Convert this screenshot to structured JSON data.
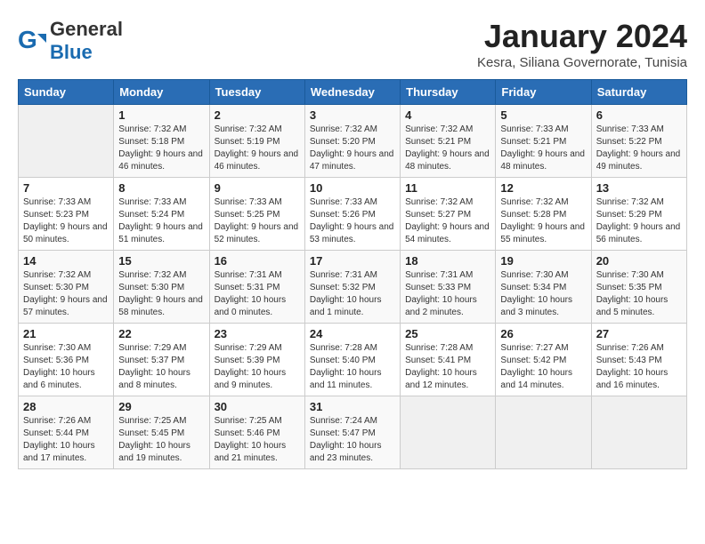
{
  "header": {
    "logo_general": "General",
    "logo_blue": "Blue",
    "month_year": "January 2024",
    "location": "Kesra, Siliana Governorate, Tunisia"
  },
  "weekdays": [
    "Sunday",
    "Monday",
    "Tuesday",
    "Wednesday",
    "Thursday",
    "Friday",
    "Saturday"
  ],
  "weeks": [
    [
      {
        "day": "",
        "sunrise": "",
        "sunset": "",
        "daylight": ""
      },
      {
        "day": "1",
        "sunrise": "Sunrise: 7:32 AM",
        "sunset": "Sunset: 5:18 PM",
        "daylight": "Daylight: 9 hours and 46 minutes."
      },
      {
        "day": "2",
        "sunrise": "Sunrise: 7:32 AM",
        "sunset": "Sunset: 5:19 PM",
        "daylight": "Daylight: 9 hours and 46 minutes."
      },
      {
        "day": "3",
        "sunrise": "Sunrise: 7:32 AM",
        "sunset": "Sunset: 5:20 PM",
        "daylight": "Daylight: 9 hours and 47 minutes."
      },
      {
        "day": "4",
        "sunrise": "Sunrise: 7:32 AM",
        "sunset": "Sunset: 5:21 PM",
        "daylight": "Daylight: 9 hours and 48 minutes."
      },
      {
        "day": "5",
        "sunrise": "Sunrise: 7:33 AM",
        "sunset": "Sunset: 5:21 PM",
        "daylight": "Daylight: 9 hours and 48 minutes."
      },
      {
        "day": "6",
        "sunrise": "Sunrise: 7:33 AM",
        "sunset": "Sunset: 5:22 PM",
        "daylight": "Daylight: 9 hours and 49 minutes."
      }
    ],
    [
      {
        "day": "7",
        "sunrise": "Sunrise: 7:33 AM",
        "sunset": "Sunset: 5:23 PM",
        "daylight": "Daylight: 9 hours and 50 minutes."
      },
      {
        "day": "8",
        "sunrise": "Sunrise: 7:33 AM",
        "sunset": "Sunset: 5:24 PM",
        "daylight": "Daylight: 9 hours and 51 minutes."
      },
      {
        "day": "9",
        "sunrise": "Sunrise: 7:33 AM",
        "sunset": "Sunset: 5:25 PM",
        "daylight": "Daylight: 9 hours and 52 minutes."
      },
      {
        "day": "10",
        "sunrise": "Sunrise: 7:33 AM",
        "sunset": "Sunset: 5:26 PM",
        "daylight": "Daylight: 9 hours and 53 minutes."
      },
      {
        "day": "11",
        "sunrise": "Sunrise: 7:32 AM",
        "sunset": "Sunset: 5:27 PM",
        "daylight": "Daylight: 9 hours and 54 minutes."
      },
      {
        "day": "12",
        "sunrise": "Sunrise: 7:32 AM",
        "sunset": "Sunset: 5:28 PM",
        "daylight": "Daylight: 9 hours and 55 minutes."
      },
      {
        "day": "13",
        "sunrise": "Sunrise: 7:32 AM",
        "sunset": "Sunset: 5:29 PM",
        "daylight": "Daylight: 9 hours and 56 minutes."
      }
    ],
    [
      {
        "day": "14",
        "sunrise": "Sunrise: 7:32 AM",
        "sunset": "Sunset: 5:30 PM",
        "daylight": "Daylight: 9 hours and 57 minutes."
      },
      {
        "day": "15",
        "sunrise": "Sunrise: 7:32 AM",
        "sunset": "Sunset: 5:30 PM",
        "daylight": "Daylight: 9 hours and 58 minutes."
      },
      {
        "day": "16",
        "sunrise": "Sunrise: 7:31 AM",
        "sunset": "Sunset: 5:31 PM",
        "daylight": "Daylight: 10 hours and 0 minutes."
      },
      {
        "day": "17",
        "sunrise": "Sunrise: 7:31 AM",
        "sunset": "Sunset: 5:32 PM",
        "daylight": "Daylight: 10 hours and 1 minute."
      },
      {
        "day": "18",
        "sunrise": "Sunrise: 7:31 AM",
        "sunset": "Sunset: 5:33 PM",
        "daylight": "Daylight: 10 hours and 2 minutes."
      },
      {
        "day": "19",
        "sunrise": "Sunrise: 7:30 AM",
        "sunset": "Sunset: 5:34 PM",
        "daylight": "Daylight: 10 hours and 3 minutes."
      },
      {
        "day": "20",
        "sunrise": "Sunrise: 7:30 AM",
        "sunset": "Sunset: 5:35 PM",
        "daylight": "Daylight: 10 hours and 5 minutes."
      }
    ],
    [
      {
        "day": "21",
        "sunrise": "Sunrise: 7:30 AM",
        "sunset": "Sunset: 5:36 PM",
        "daylight": "Daylight: 10 hours and 6 minutes."
      },
      {
        "day": "22",
        "sunrise": "Sunrise: 7:29 AM",
        "sunset": "Sunset: 5:37 PM",
        "daylight": "Daylight: 10 hours and 8 minutes."
      },
      {
        "day": "23",
        "sunrise": "Sunrise: 7:29 AM",
        "sunset": "Sunset: 5:39 PM",
        "daylight": "Daylight: 10 hours and 9 minutes."
      },
      {
        "day": "24",
        "sunrise": "Sunrise: 7:28 AM",
        "sunset": "Sunset: 5:40 PM",
        "daylight": "Daylight: 10 hours and 11 minutes."
      },
      {
        "day": "25",
        "sunrise": "Sunrise: 7:28 AM",
        "sunset": "Sunset: 5:41 PM",
        "daylight": "Daylight: 10 hours and 12 minutes."
      },
      {
        "day": "26",
        "sunrise": "Sunrise: 7:27 AM",
        "sunset": "Sunset: 5:42 PM",
        "daylight": "Daylight: 10 hours and 14 minutes."
      },
      {
        "day": "27",
        "sunrise": "Sunrise: 7:26 AM",
        "sunset": "Sunset: 5:43 PM",
        "daylight": "Daylight: 10 hours and 16 minutes."
      }
    ],
    [
      {
        "day": "28",
        "sunrise": "Sunrise: 7:26 AM",
        "sunset": "Sunset: 5:44 PM",
        "daylight": "Daylight: 10 hours and 17 minutes."
      },
      {
        "day": "29",
        "sunrise": "Sunrise: 7:25 AM",
        "sunset": "Sunset: 5:45 PM",
        "daylight": "Daylight: 10 hours and 19 minutes."
      },
      {
        "day": "30",
        "sunrise": "Sunrise: 7:25 AM",
        "sunset": "Sunset: 5:46 PM",
        "daylight": "Daylight: 10 hours and 21 minutes."
      },
      {
        "day": "31",
        "sunrise": "Sunrise: 7:24 AM",
        "sunset": "Sunset: 5:47 PM",
        "daylight": "Daylight: 10 hours and 23 minutes."
      },
      {
        "day": "",
        "sunrise": "",
        "sunset": "",
        "daylight": ""
      },
      {
        "day": "",
        "sunrise": "",
        "sunset": "",
        "daylight": ""
      },
      {
        "day": "",
        "sunrise": "",
        "sunset": "",
        "daylight": ""
      }
    ]
  ]
}
